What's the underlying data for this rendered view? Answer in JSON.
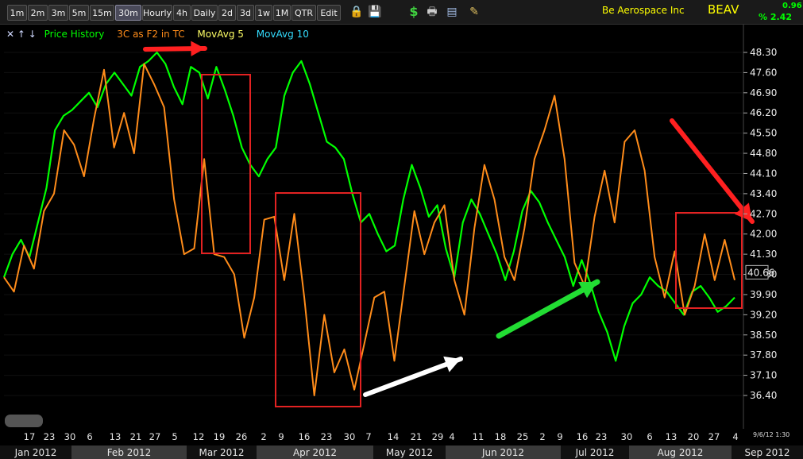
{
  "toolbar": {
    "timeframes": [
      "1m",
      "2m",
      "3m",
      "5m",
      "15m",
      "30m",
      "Hourly",
      "4h",
      "Daily",
      "2d",
      "3d",
      "1w",
      "1M",
      "QTR",
      "Edit"
    ],
    "active": "30m",
    "icons": [
      "lock-icon",
      "save-icon",
      "dollar-icon",
      "print-icon",
      "card-icon",
      "pencil-icon"
    ]
  },
  "header": {
    "company": "Be Aerospace Inc",
    "ticker": "BEAV",
    "change": "0.96",
    "change_pct": "% 2.42"
  },
  "legend": {
    "arrows": "✕ ↑ ↓",
    "items": [
      {
        "label": "Price History",
        "color": "#00ff00"
      },
      {
        "label": "3C as F2 in TC",
        "color": "#ff8c1a"
      },
      {
        "label": "MovAvg 5",
        "color": "#ffff66"
      },
      {
        "label": "MovAvg 10",
        "color": "#33ddff"
      }
    ]
  },
  "chart_data": {
    "type": "line",
    "ylim": [
      36.0,
      48.6
    ],
    "y_ticks": [
      48.3,
      47.6,
      46.9,
      46.2,
      45.5,
      44.8,
      44.1,
      43.4,
      42.7,
      42.0,
      41.3,
      40.6,
      39.9,
      39.2,
      38.5,
      37.8,
      37.1,
      36.4
    ],
    "y_tick_labels": [
      "48.30",
      "47.60",
      "46.90",
      "46.20",
      "45.50",
      "44.80",
      "44.10",
      "43.40",
      "42.70",
      "42.00",
      "41.30",
      "40.60",
      "39.90",
      "39.20",
      "38.50",
      "37.80",
      "37.10",
      "36.40"
    ],
    "current_price": "40.66",
    "x_tick_labels": [
      "17",
      "23",
      "30",
      "6",
      "13",
      "21",
      "27",
      "5",
      "12",
      "19",
      "26",
      "2",
      "9",
      "16",
      "23",
      "30",
      "7",
      "14",
      "21",
      "29",
      "4",
      "11",
      "18",
      "25",
      "2",
      "9",
      "16",
      "23",
      "30",
      "6",
      "13",
      "20",
      "27",
      "4"
    ],
    "months": [
      "Jan 2012",
      "Feb 2012",
      "Mar 2012",
      "Apr 2012",
      "May 2012",
      "Jun 2012",
      "Jul 2012",
      "Aug 2012",
      "Sep 2012"
    ],
    "last_date": "9/6/12 1:30",
    "series": [
      {
        "name": "Price History",
        "color": "#00ff00",
        "values": [
          40.5,
          41.3,
          41.8,
          41.2,
          42.4,
          43.6,
          45.6,
          46.1,
          46.3,
          46.6,
          46.9,
          46.4,
          47.2,
          47.6,
          47.2,
          46.8,
          47.8,
          48.0,
          48.3,
          47.9,
          47.1,
          46.5,
          47.8,
          47.6,
          46.7,
          47.8,
          47.0,
          46.1,
          45.0,
          44.4,
          44.0,
          44.6,
          45.0,
          46.8,
          47.6,
          48.0,
          47.2,
          46.2,
          45.2,
          45.0,
          44.6,
          43.4,
          42.4,
          42.7,
          42.0,
          41.4,
          41.6,
          43.2,
          44.4,
          43.6,
          42.6,
          43.0,
          41.5,
          40.5,
          42.4,
          43.2,
          42.7,
          42.0,
          41.3,
          40.4,
          41.4,
          42.8,
          43.5,
          43.1,
          42.4,
          41.8,
          41.2,
          40.2,
          41.1,
          40.3,
          39.3,
          38.6,
          37.6,
          38.8,
          39.6,
          39.9,
          40.5,
          40.2,
          40.0,
          39.6,
          39.2,
          40.0,
          40.2,
          39.8,
          39.3,
          39.5,
          39.8
        ]
      },
      {
        "name": "3C as F2 in TC",
        "color": "#ff8c1a",
        "values": [
          40.5,
          40.0,
          41.6,
          40.8,
          42.8,
          43.4,
          45.6,
          45.1,
          44.0,
          46.0,
          47.7,
          45.0,
          46.2,
          44.8,
          47.9,
          47.2,
          46.4,
          43.2,
          41.3,
          41.5,
          44.6,
          41.3,
          41.2,
          40.6,
          38.4,
          39.8,
          42.5,
          42.6,
          40.4,
          42.7,
          39.8,
          36.4,
          39.2,
          37.2,
          38.0,
          36.6,
          38.2,
          39.8,
          40.0,
          37.6,
          40.2,
          42.8,
          41.3,
          42.4,
          43.0,
          40.4,
          39.2,
          42.2,
          44.4,
          43.2,
          41.2,
          40.4,
          42.2,
          44.6,
          45.6,
          46.8,
          44.6,
          41.0,
          40.2,
          42.6,
          44.2,
          42.4,
          45.2,
          45.6,
          44.2,
          41.2,
          39.8,
          41.4,
          39.2,
          40.2,
          42.0,
          40.4,
          41.8,
          40.4
        ]
      }
    ],
    "annotations": [
      "red-box",
      "red-box",
      "red-box",
      "red-arrow",
      "red-arrow",
      "white-arrow",
      "green-arrow"
    ]
  }
}
